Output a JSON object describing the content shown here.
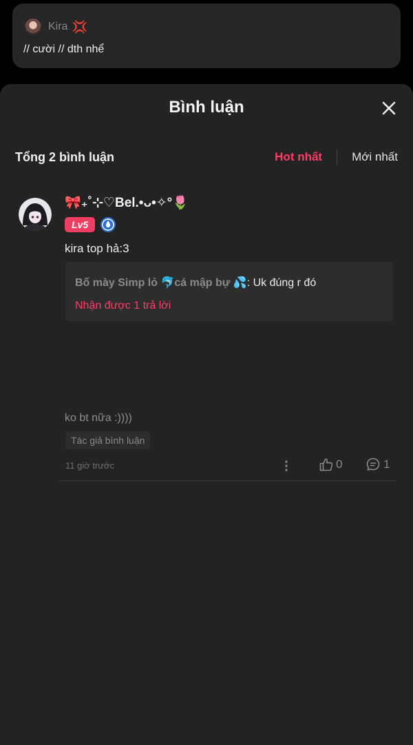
{
  "top_post": {
    "author": "Kira",
    "author_emoji": "💢",
    "text": "// cười // dth nhể"
  },
  "sheet": {
    "title": "Bình luận",
    "total_label": "Tổng 2 bình luận",
    "sort_hot": "Hot nhất",
    "sort_new": "Mới nhất"
  },
  "comment": {
    "user_name": "🎀₊˚⊹♡Bel.•ᴗ•✧°🌷",
    "level_badge": "Lv5",
    "text": "kira top hả:3",
    "reply_preview": {
      "author": "Bố mày Simp lỏ 🐬cá mập bự 💦",
      "separator": ":",
      "content": "Uk đúng r đó",
      "more_label": "Nhận được 1 trả lời"
    },
    "author_note": "ko bt nữa :))))",
    "author_tag": "Tác giả bình luận",
    "time": "11 giờ trước",
    "like_count": "0",
    "reply_count": "1"
  },
  "colors": {
    "accent": "#ff3d67",
    "sheet_bg": "#232323",
    "card_bg": "#262626"
  },
  "icons": [
    "anger-icon",
    "close-icon",
    "verified-icon",
    "more-vertical-icon",
    "thumbs-up-icon",
    "comment-bubble-icon"
  ]
}
